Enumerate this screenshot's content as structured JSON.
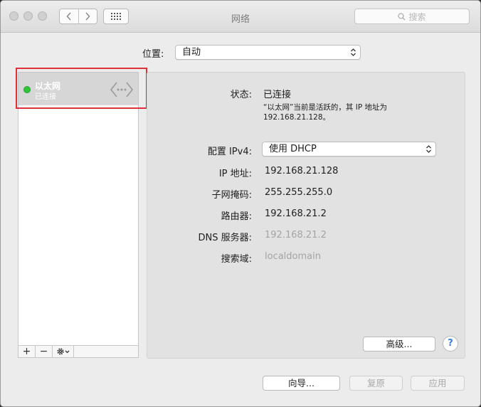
{
  "window": {
    "title": "网络",
    "search_placeholder": "搜索"
  },
  "location": {
    "label": "位置:",
    "value": "自动"
  },
  "services": [
    {
      "name": "以太网",
      "status": "已连接",
      "status_color": "#2ec53a",
      "icon": "ethernet-arrows-icon"
    }
  ],
  "list_toolbar": {
    "add": "+",
    "remove": "−"
  },
  "details": {
    "status_label": "状态:",
    "status_value": "已连接",
    "status_desc_line1": "“以太网”当前是活跃的，其 IP 地址为",
    "status_desc_line2": "192.168.21.128。",
    "config_label": "配置 IPv4:",
    "config_value": "使用 DHCP",
    "ip_label": "IP 地址:",
    "ip_value": "192.168.21.128",
    "mask_label": "子网掩码:",
    "mask_value": "255.255.255.0",
    "router_label": "路由器:",
    "router_value": "192.168.21.2",
    "dns_label": "DNS 服务器:",
    "dns_value": "192.168.21.2",
    "search_domain_label": "搜索域:",
    "search_domain_value": "localdomain",
    "advanced_button": "高级...",
    "help_button": "?"
  },
  "footer": {
    "assist_button": "向导...",
    "revert_button": "复原",
    "apply_button": "应用"
  },
  "colors": {
    "highlight": "#e0303a",
    "connected": "#2ec53a"
  }
}
